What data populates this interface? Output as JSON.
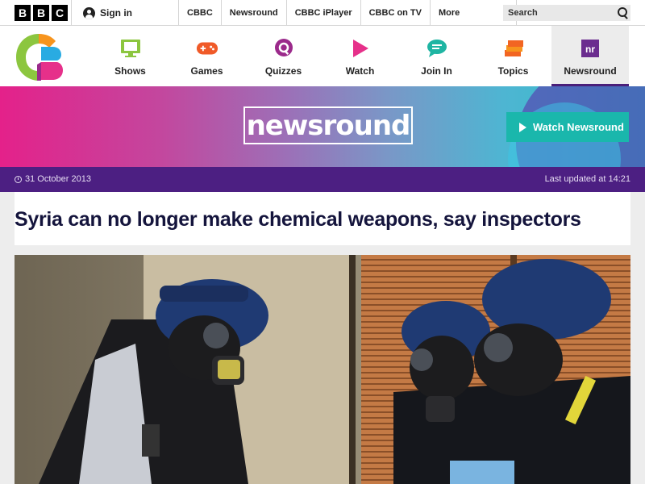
{
  "bbc_bar": {
    "logo_letters": [
      "B",
      "B",
      "C"
    ],
    "sign_in": "Sign in",
    "nav": [
      "CBBC",
      "Newsround",
      "CBBC iPlayer",
      "CBBC on TV"
    ],
    "more": "More",
    "search_placeholder": "Search"
  },
  "cbbc_nav": {
    "items": [
      {
        "label": "Shows",
        "icon": "monitor-icon",
        "color": "#8cc63f"
      },
      {
        "label": "Games",
        "icon": "gamepad-icon",
        "color": "#f05a28"
      },
      {
        "label": "Quizzes",
        "icon": "quiz-icon",
        "color": "#9b2a8b"
      },
      {
        "label": "Watch",
        "icon": "play-icon",
        "color": "#e6308a"
      },
      {
        "label": "Join In",
        "icon": "speech-bubble-icon",
        "color": "#1fb5a3"
      },
      {
        "label": "Topics",
        "icon": "stack-icon",
        "color": "#f26522"
      },
      {
        "label": "Newsround",
        "icon": "newsround-icon",
        "color": "#6b2d8f"
      }
    ],
    "newsround_icon_text": "nr"
  },
  "banner": {
    "logo_text": "newsround",
    "watch_button": "Watch Newsround"
  },
  "date_strip": {
    "date": "31 October 2013",
    "updated": "Last updated at 14:21"
  },
  "article": {
    "headline": "Syria can no longer make chemical weapons, say inspectors"
  },
  "colors": {
    "accent_purple": "#4c1f82",
    "teal_button": "#1ab7ac",
    "headline": "#14143c"
  }
}
